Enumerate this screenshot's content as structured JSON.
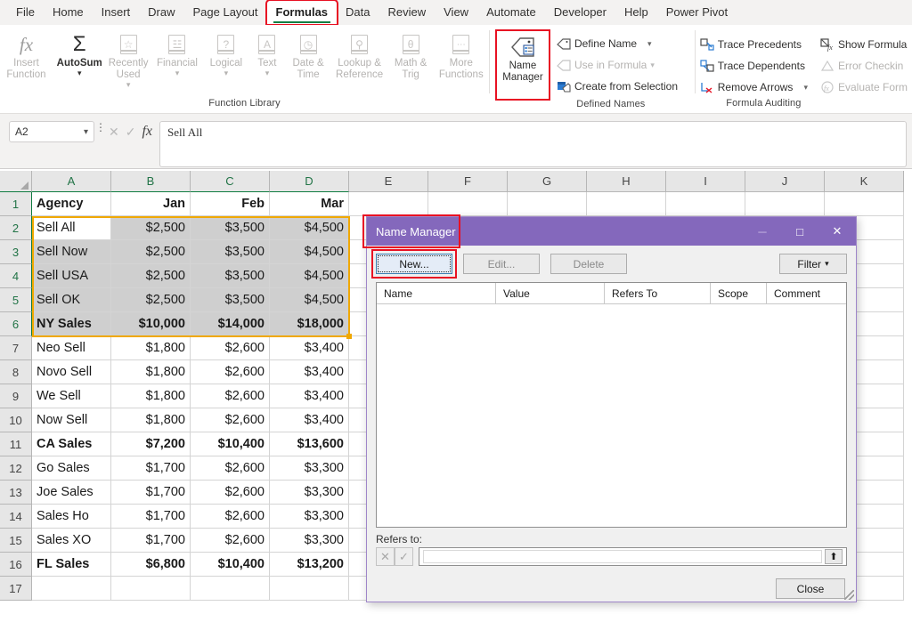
{
  "app": {
    "tabs": [
      {
        "label": "File",
        "active": false,
        "annotated": false
      },
      {
        "label": "Home",
        "active": false,
        "annotated": false
      },
      {
        "label": "Insert",
        "active": false,
        "annotated": false
      },
      {
        "label": "Draw",
        "active": false,
        "annotated": false
      },
      {
        "label": "Page Layout",
        "active": false,
        "annotated": false
      },
      {
        "label": "Formulas",
        "active": true,
        "annotated": true
      },
      {
        "label": "Data",
        "active": false,
        "annotated": false
      },
      {
        "label": "Review",
        "active": false,
        "annotated": false
      },
      {
        "label": "View",
        "active": false,
        "annotated": false
      },
      {
        "label": "Automate",
        "active": false,
        "annotated": false
      },
      {
        "label": "Developer",
        "active": false,
        "annotated": false
      },
      {
        "label": "Help",
        "active": false,
        "annotated": false
      },
      {
        "label": "Power Pivot",
        "active": false,
        "annotated": false
      }
    ]
  },
  "ribbon": {
    "groups": {
      "function_library": {
        "label": "Function Library",
        "buttons": [
          {
            "name": "insert-function",
            "label": "Insert\nFunction",
            "icon": "fx-icon",
            "dim": true,
            "chevron": false
          },
          {
            "name": "autosum",
            "label": "AutoSum",
            "icon": "sigma-icon",
            "dim": false,
            "chevron": true
          },
          {
            "name": "recently-used",
            "label": "Recently\nUsed",
            "icon": "star-icon",
            "glyph": "☆",
            "dim": true,
            "chevron": true
          },
          {
            "name": "financial",
            "label": "Financial",
            "icon": "coins-icon",
            "glyph": "≣",
            "dim": true,
            "chevron": true
          },
          {
            "name": "logical",
            "label": "Logical",
            "icon": "question-icon",
            "glyph": "?",
            "dim": true,
            "chevron": true
          },
          {
            "name": "text",
            "label": "Text",
            "icon": "letter-a-icon",
            "glyph": "A",
            "dim": true,
            "chevron": true
          },
          {
            "name": "date-time",
            "label": "Date &\nTime",
            "icon": "clock-icon",
            "glyph": "◴",
            "dim": true,
            "chevron": true
          },
          {
            "name": "lookup-reference",
            "label": "Lookup &\nReference",
            "icon": "magnifier-icon",
            "glyph": "⚲",
            "dim": true,
            "chevron": true
          },
          {
            "name": "math-trig",
            "label": "Math &\nTrig",
            "icon": "theta-icon",
            "glyph": "θ",
            "dim": true,
            "chevron": true
          },
          {
            "name": "more-functions",
            "label": "More\nFunctions",
            "icon": "ellipsis-icon",
            "glyph": "···",
            "dim": true,
            "chevron": true
          }
        ]
      },
      "defined_names": {
        "label": "Defined Names",
        "name_manager": {
          "label": "Name\nManager",
          "annotated": true
        },
        "items": [
          {
            "name": "define-name",
            "label": "Define Name",
            "dim": false,
            "chevron": true
          },
          {
            "name": "use-in-formula",
            "label": "Use in Formula",
            "dim": true,
            "chevron": true
          },
          {
            "name": "create-from-selection",
            "label": "Create from Selection",
            "dim": false,
            "chevron": false
          }
        ]
      },
      "formula_auditing": {
        "label": "Formula Auditing",
        "col1": [
          {
            "name": "trace-precedents",
            "label": "Trace Precedents",
            "dim": false,
            "chevron": false
          },
          {
            "name": "trace-dependents",
            "label": "Trace Dependents",
            "dim": false,
            "chevron": false
          },
          {
            "name": "remove-arrows",
            "label": "Remove Arrows",
            "dim": false,
            "chevron": true
          }
        ],
        "col2": [
          {
            "name": "show-formulas",
            "label": "Show Formula",
            "dim": false,
            "chevron": false
          },
          {
            "name": "error-checking",
            "label": "Error Checkin",
            "dim": true,
            "chevron": false
          },
          {
            "name": "evaluate-formula",
            "label": "Evaluate Form",
            "dim": true,
            "chevron": false
          }
        ]
      }
    }
  },
  "formula_bar": {
    "name_box_value": "A2",
    "cancel_icon": "✕",
    "enter_icon": "✓",
    "fx_label": "fx",
    "content": "Sell All"
  },
  "sheet": {
    "column_headers": [
      "A",
      "B",
      "C",
      "D",
      "E",
      "F",
      "G",
      "H",
      "I",
      "J",
      "K"
    ],
    "row_numbers": [
      "1",
      "2",
      "3",
      "4",
      "5",
      "6",
      "7",
      "8",
      "9",
      "10",
      "11",
      "12",
      "13",
      "14",
      "15",
      "16",
      "17"
    ],
    "headers": [
      "Agency",
      "Jan",
      "Feb",
      "Mar"
    ],
    "rows": [
      {
        "row": "1",
        "cells": [
          "Agency",
          "Jan",
          "Feb",
          "Mar"
        ],
        "bold": true,
        "selected": false
      },
      {
        "row": "2",
        "cells": [
          "Sell All",
          "$2,500",
          "$3,500",
          "$4,500"
        ],
        "bold": false,
        "selected": true,
        "active": true
      },
      {
        "row": "3",
        "cells": [
          "Sell Now",
          "$2,500",
          "$3,500",
          "$4,500"
        ],
        "bold": false,
        "selected": true
      },
      {
        "row": "4",
        "cells": [
          "Sell USA",
          "$2,500",
          "$3,500",
          "$4,500"
        ],
        "bold": false,
        "selected": true
      },
      {
        "row": "5",
        "cells": [
          "Sell OK",
          "$2,500",
          "$3,500",
          "$4,500"
        ],
        "bold": false,
        "selected": true
      },
      {
        "row": "6",
        "cells": [
          "NY Sales",
          "$10,000",
          "$14,000",
          "$18,000"
        ],
        "bold": true,
        "selected": true
      },
      {
        "row": "7",
        "cells": [
          "Neo Sell",
          "$1,800",
          "$2,600",
          "$3,400"
        ],
        "bold": false,
        "selected": false
      },
      {
        "row": "8",
        "cells": [
          "Novo Sell",
          "$1,800",
          "$2,600",
          "$3,400"
        ],
        "bold": false,
        "selected": false
      },
      {
        "row": "9",
        "cells": [
          "We Sell",
          "$1,800",
          "$2,600",
          "$3,400"
        ],
        "bold": false,
        "selected": false
      },
      {
        "row": "10",
        "cells": [
          "Now Sell",
          "$1,800",
          "$2,600",
          "$3,400"
        ],
        "bold": false,
        "selected": false
      },
      {
        "row": "11",
        "cells": [
          "CA Sales",
          "$7,200",
          "$10,400",
          "$13,600"
        ],
        "bold": true,
        "selected": false
      },
      {
        "row": "12",
        "cells": [
          "Go Sales",
          "$1,700",
          "$2,600",
          "$3,300"
        ],
        "bold": false,
        "selected": false
      },
      {
        "row": "13",
        "cells": [
          "Joe Sales",
          "$1,700",
          "$2,600",
          "$3,300"
        ],
        "bold": false,
        "selected": false
      },
      {
        "row": "14",
        "cells": [
          "Sales Ho",
          "$1,700",
          "$2,600",
          "$3,300"
        ],
        "bold": false,
        "selected": false
      },
      {
        "row": "15",
        "cells": [
          "Sales XO",
          "$1,700",
          "$2,600",
          "$3,300"
        ],
        "bold": false,
        "selected": false
      },
      {
        "row": "16",
        "cells": [
          "FL Sales",
          "$6,800",
          "$10,400",
          "$13,200"
        ],
        "bold": true,
        "selected": false
      },
      {
        "row": "17",
        "cells": [
          "",
          "",
          "",
          ""
        ],
        "bold": false,
        "selected": false
      }
    ],
    "selection_range": "A2:D6"
  },
  "dialog": {
    "title": "Name Manager",
    "minimize_icon": "─",
    "maximize_icon": "□",
    "close_icon": "✕",
    "buttons": {
      "new": "New...",
      "edit": "Edit...",
      "delete": "Delete",
      "filter": "Filter",
      "filter_caret": "▾",
      "close": "Close"
    },
    "list_columns": [
      "Name",
      "Value",
      "Refers To",
      "Scope",
      "Comment"
    ],
    "list_rows": [],
    "refers_to_label": "Refers to:",
    "refers_to_value": "",
    "refers_cancel_icon": "✕",
    "refers_accept_icon": "✓",
    "collapse_icon": "⬆"
  },
  "colors": {
    "dialog_title_bg": "#8468bc",
    "annotation_red": "#e81123",
    "selection_orange": "#f0a800",
    "excel_green": "#107c41",
    "selection_fill": "#cfcfcf"
  }
}
